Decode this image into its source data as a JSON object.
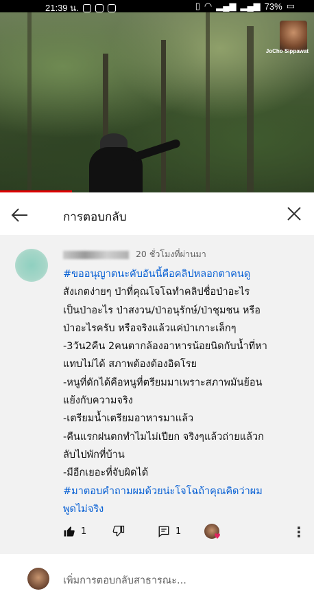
{
  "status_bar": {
    "time": "21:39 น.",
    "battery": "73%"
  },
  "video": {
    "watermark": "JoCho Sippawat",
    "progress": 0.23
  },
  "reply_panel": {
    "title": "การตอบกลับ"
  },
  "comment": {
    "time_ago": "20 ชั่วโมงที่ผ่านมา",
    "lines": [
      "#ขออนุญาตนะคับอันนี้คือคลิปหลอกตาคนดู",
      "สังเกตง่ายๆ ป่าที่คุณโจโฉทำคลิปชื่อป่าอะไร",
      "เป็นป่าอะไร ป่าสงวน/ป่าอนุรักษ์/ป่าชุมชน หรือ",
      "ป่าอะไรครับ หรือจริงแล้วแค่ป่าเกาะเล็กๆ",
      "-3วัน2คืน 2คนตากล้องอาหารน้อยนิดกับน้ำที่หา",
      "แทบไม่ได้ สภาพต้องต้องอิดโรย",
      "-หนูที่ดักได้คือหนูที่ตรียมมาเพราะสภาพมันย้อน",
      "แย้งกับความจริง",
      "-เตรียมน้ำเตรียมอาหารมาแล้ว",
      "-คืนแรกฝนตกทำไมไม่เปียก จริงๆแล้วถ่ายแล้วก",
      "ลับไปพักที่บ้าน",
      "-มีอีกเยอะที่จับผิดได้",
      "#มาตอบคำถามผมด้วยน่ะโจโฉถ้าคุณคิดว่าผม",
      "พูดไม่จริง"
    ],
    "likes": "1",
    "replies": "1"
  },
  "reply_input": {
    "placeholder": "เพิ่มการตอบกลับสาธารณะ..."
  },
  "colors": {
    "hashtag": "#065fd4",
    "progress": "#dd0000"
  }
}
